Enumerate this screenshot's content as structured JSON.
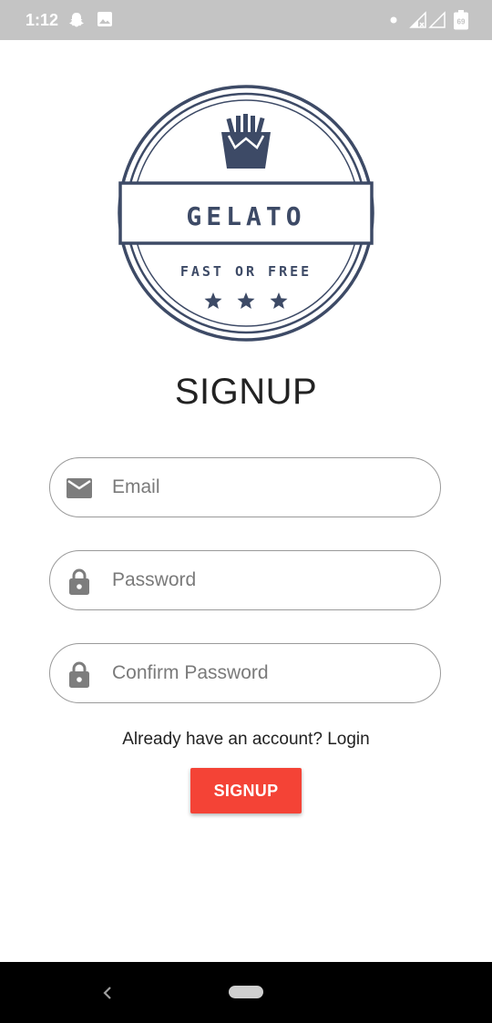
{
  "status_bar": {
    "time": "1:12",
    "icons": [
      "snapchat-icon",
      "image-icon",
      "notification-dot-icon",
      "cell-signal-icon",
      "wifi-off-icon",
      "battery-icon"
    ],
    "battery_level": "69"
  },
  "logo": {
    "brand": "GELATO",
    "tagline": "FAST OR FREE",
    "stars": 3,
    "color": "#3d4a66"
  },
  "title": "SIGNUP",
  "form": {
    "email": {
      "placeholder": "Email",
      "value": "",
      "icon": "mail-icon"
    },
    "password": {
      "placeholder": "Password",
      "value": "",
      "icon": "lock-icon"
    },
    "confirm_password": {
      "placeholder": "Confirm Password",
      "value": "",
      "icon": "lock-icon"
    }
  },
  "login_prompt": "Already have an account? Login",
  "signup_button": "SIGNUP",
  "colors": {
    "accent": "#f44336",
    "status_bar": "#c4c4c4",
    "nav_bar": "#000000"
  },
  "nav_bar": {
    "icons": [
      "back-icon",
      "home-pill-icon"
    ]
  }
}
